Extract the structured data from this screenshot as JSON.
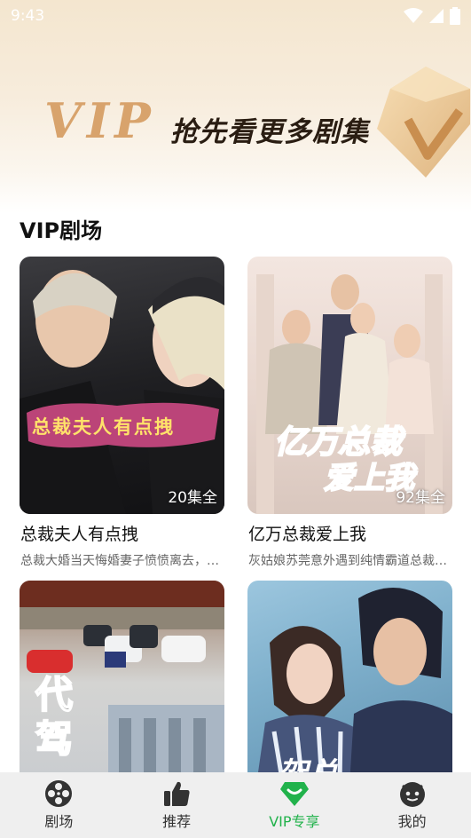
{
  "status_bar": {
    "time": "9:43"
  },
  "banner": {
    "vip_text": "VIP",
    "slogan": "抢先看更多剧集"
  },
  "section": {
    "title": "VIP剧场"
  },
  "cards": [
    {
      "title": "总裁夫人有点拽",
      "description": "总裁大婚当天悔婚妻子愤愤离去，三年后……",
      "episodes": "20集全",
      "cover_text": "总裁夫人有点拽"
    },
    {
      "title": "亿万总裁爱上我",
      "description": "灰姑娘苏莞意外遇到纯情霸道总裁……",
      "episodes": "92集全",
      "cover_text_1": "亿万总裁",
      "cover_text_2": "爱上我"
    },
    {
      "title": "",
      "description": "",
      "episodes": "",
      "cover_text": "代驾"
    },
    {
      "title": "",
      "description": "",
      "episodes": "",
      "cover_text": "架总"
    }
  ],
  "tabbar": {
    "items": [
      {
        "label": "剧场",
        "icon": "film-reel-icon"
      },
      {
        "label": "推荐",
        "icon": "thumbs-up-icon"
      },
      {
        "label": "VIP专享",
        "icon": "vip-diamond-icon"
      },
      {
        "label": "我的",
        "icon": "profile-face-icon"
      }
    ],
    "active_index": 2,
    "active_color": "#21b24b",
    "inactive_color": "#333333"
  }
}
